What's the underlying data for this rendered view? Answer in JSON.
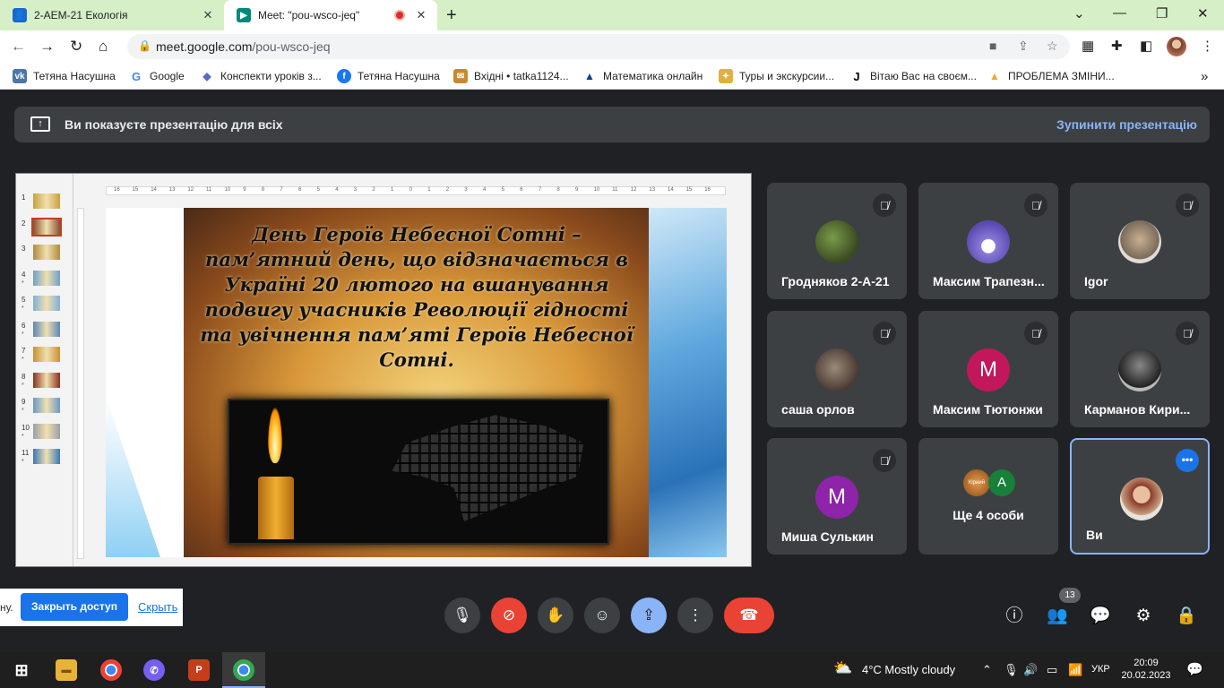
{
  "browser": {
    "tabs": [
      {
        "title": "2-AEM-21 Екологія",
        "close": "✕"
      },
      {
        "title": "Meet: \"pou-wsco-jeq\"",
        "close": "✕"
      }
    ],
    "new_tab": "+",
    "window_controls": [
      "⌄",
      "—",
      "❐",
      "✕"
    ],
    "url_host": "meet.google.com",
    "url_path": "/pou-wsco-jeq",
    "bookmarks": [
      {
        "label": "Тетяна Насушна",
        "icon": "vk-icon",
        "color": "#4a76a8",
        "glyph": "vk"
      },
      {
        "label": "Google",
        "icon": "google-icon",
        "color": "#ffffff",
        "glyph": "G"
      },
      {
        "label": "Конспекти уроків з...",
        "icon": "shield-icon",
        "color": "#5c6bc0",
        "glyph": "◆"
      },
      {
        "label": "Тетяна Насушна",
        "icon": "facebook-icon",
        "color": "#1877f2",
        "glyph": "f"
      },
      {
        "label": "Вхідні • tatka1124...",
        "icon": "mail-icon",
        "color": "#c98a2b",
        "glyph": "✉"
      },
      {
        "label": "Математика онлайн",
        "icon": "math-icon",
        "color": "#1a3a8a",
        "glyph": "▲"
      },
      {
        "label": "Туры и экскурсии...",
        "icon": "tour-icon",
        "color": "#e0b040",
        "glyph": "✦"
      },
      {
        "label": "Вітаю Вас на своєм...",
        "icon": "j-icon",
        "color": "#ffffff",
        "glyph": "J"
      },
      {
        "label": "ПРОБЛЕМА ЗМІНИ...",
        "icon": "bell-icon",
        "color": "#f2a81d",
        "glyph": "▲"
      }
    ],
    "bookmarks_more": "»"
  },
  "meet": {
    "banner_text": "Ви показуєте презентацію для всіх",
    "stop_label": "Зупинити презентацію",
    "slide_title": "День Героїв Небесної Сотні – пам’ятний день, що відзначається в Україні 20 лютого на вшанування подвигу учасників Революції гідності та увічнення пам’яті Героїв Небесної Сотні.",
    "slide_numbers": [
      "1",
      "2",
      "3",
      "4",
      "5",
      "6",
      "7",
      "8",
      "9",
      "10",
      "11"
    ],
    "ruler_ticks": [
      "16",
      "15",
      "14",
      "13",
      "12",
      "11",
      "10",
      "9",
      "8",
      "7",
      "6",
      "5",
      "4",
      "3",
      "2",
      "1",
      "0",
      "1",
      "2",
      "3",
      "4",
      "5",
      "6",
      "7",
      "8",
      "9",
      "10",
      "11",
      "12",
      "13",
      "14",
      "15",
      "16"
    ],
    "participants": [
      {
        "name": "Гродняков 2-А-21",
        "avatar": "",
        "avatar_color": "#4a6a2a",
        "photo": true
      },
      {
        "name": "Максим Трапезн...",
        "avatar": "",
        "avatar_color": "#6a5acd",
        "photo": true
      },
      {
        "name": "Igor",
        "avatar": "",
        "avatar_color": "#8a7a6a",
        "photo": true
      },
      {
        "name": "саша орлов",
        "avatar": "",
        "avatar_color": "#6a5a52",
        "photo": true
      },
      {
        "name": "Максим Тютюнжи",
        "avatar": "M",
        "avatar_color": "#c2185b",
        "photo": false
      },
      {
        "name": "Карманов Кири...",
        "avatar": "",
        "avatar_color": "#333333",
        "photo": true
      },
      {
        "name": "Миша Сулькин",
        "avatar": "M",
        "avatar_color": "#8e24aa",
        "photo": false
      }
    ],
    "others": {
      "label": "Ще 4 особи",
      "avatar_letter": "A",
      "avatar_tag": "Кірний"
    },
    "me": {
      "name": "Ви",
      "more": "•••"
    },
    "participant_count": "13"
  },
  "popup": {
    "fragment": "ну.",
    "primary": "Закрыть доступ",
    "secondary": "Скрыть"
  },
  "taskbar": {
    "weather": "4°C  Mostly cloudy",
    "lang": "УКР",
    "time": "20:09",
    "date": "20.02.2023"
  }
}
